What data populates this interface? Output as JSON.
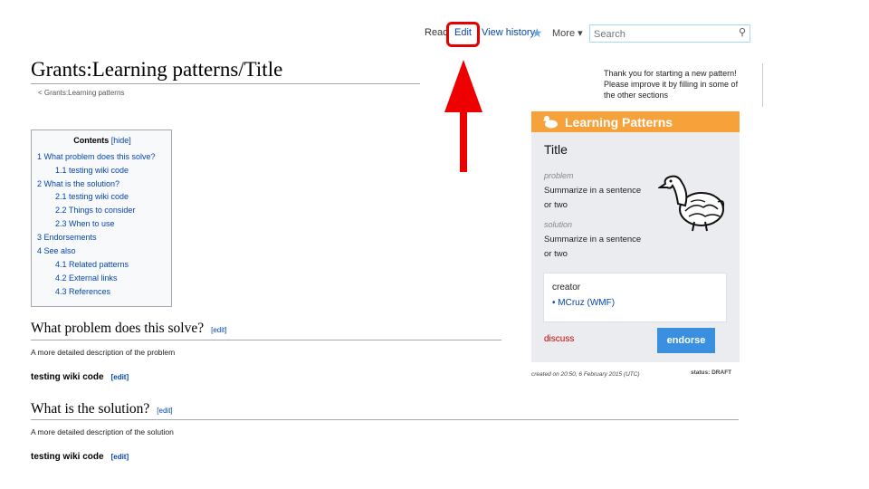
{
  "tabs": {
    "read": "Read",
    "edit": "Edit",
    "view_history": "View history",
    "more": "More ▾"
  },
  "search": {
    "placeholder": "Search",
    "icon": "magnifier-icon"
  },
  "page": {
    "title": "Grants:Learning patterns/Title",
    "breadcrumb": "< Grants:Learning patterns"
  },
  "notice": {
    "line1": "Thank you for starting a new pattern!",
    "line2": "Please improve it by filling in some of",
    "line3": "the other sections"
  },
  "learning_pattern": {
    "header": "Learning Patterns",
    "title": "Title",
    "problem_label": "problem",
    "problem_line1": "Summarize in a sentence",
    "problem_line2": "or two",
    "solution_label": "solution",
    "solution_line1": "Summarize in a sentence",
    "solution_line2": "or two",
    "creator_label": "creator",
    "creator_name": "• MCruz (WMF)",
    "discuss": "discuss",
    "endorse": "endorse",
    "created": "created on 20:50, 6 February 2015 (UTC)",
    "status": "status: DRAFT",
    "header_color": "#f7a13a",
    "endorse_color": "#3a8fe0"
  },
  "toc": {
    "heading": "Contents",
    "hide": "[hide]",
    "items": [
      "1 What problem does this solve?",
      "1.1 testing wiki code",
      "2 What is the solution?",
      "2.1 testing wiki code",
      "2.2 Things to consider",
      "2.3 When to use",
      "3 Endorsements",
      "4 See also",
      "4.1 Related patterns",
      "4.2 External links",
      "4.3 References"
    ]
  },
  "sections": {
    "s1_heading": "What problem does this solve?",
    "s1_text": "A more detailed description of the problem",
    "s1_sub": "testing wiki code",
    "s2_heading": "What is the solution?",
    "s2_text": "A more detailed description of the solution",
    "s2_sub": "testing wiki code",
    "edit": "[edit]"
  },
  "annotation": {
    "highlight_color": "#e60000",
    "arrow_color": "#ee0000"
  }
}
